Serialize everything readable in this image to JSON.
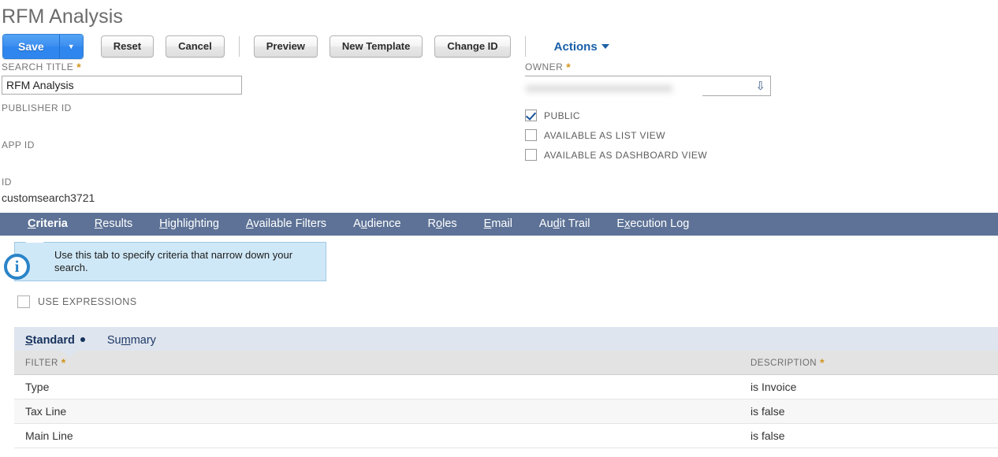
{
  "page": {
    "title": "RFM Analysis"
  },
  "toolbar": {
    "save_label": "Save",
    "save_dropdown_icon": "caret-down-icon",
    "reset_label": "Reset",
    "cancel_label": "Cancel",
    "preview_label": "Preview",
    "new_template_label": "New Template",
    "change_id_label": "Change ID",
    "actions_label": "Actions",
    "actions_caret_icon": "caret-down-icon"
  },
  "form": {
    "left": {
      "search_title_label": "SEARCH TITLE",
      "search_title_required": "*",
      "search_title_value": "RFM Analysis",
      "search_title_placeholder": "",
      "publisher_id_label": "PUBLISHER ID",
      "publisher_id_value": "",
      "app_id_label": "APP ID",
      "app_id_value": "",
      "id_label": "ID",
      "id_value": "customsearch3721"
    },
    "right": {
      "owner_label": "OWNER",
      "owner_required": "*",
      "owner_value": "",
      "owner_dropdown_icon": "chevron-double-down-icon",
      "checkboxes": [
        {
          "label": "PUBLIC",
          "checked": true
        },
        {
          "label": "AVAILABLE AS LIST VIEW",
          "checked": false
        },
        {
          "label": "AVAILABLE AS DASHBOARD VIEW",
          "checked": false
        }
      ]
    }
  },
  "tabs": [
    {
      "label": "Criteria",
      "accel": "C",
      "active": true
    },
    {
      "label": "Results",
      "accel": "R",
      "active": false
    },
    {
      "label": "Highlighting",
      "accel": "H",
      "active": false
    },
    {
      "label": "Available Filters",
      "accel": "A",
      "active": false
    },
    {
      "label": "Audience",
      "accel": "u",
      "active": false
    },
    {
      "label": "Roles",
      "accel": "o",
      "active": false
    },
    {
      "label": "Email",
      "accel": "E",
      "active": false
    },
    {
      "label": "Audit Trail",
      "accel": "d",
      "active": false
    },
    {
      "label": "Execution Log",
      "accel": "x",
      "active": false
    }
  ],
  "tooltip": {
    "icon": "info-icon",
    "text": "Use this tab to specify criteria that narrow down your search."
  },
  "use_expressions": {
    "label": "USE EXPRESSIONS",
    "checked": false
  },
  "subtabs": [
    {
      "label": "Standard",
      "accel": "S",
      "active": true,
      "dot": true
    },
    {
      "label": "Summary",
      "accel": "m",
      "active": false,
      "dot": false
    }
  ],
  "table": {
    "columns": [
      {
        "label": "FILTER",
        "required": "*"
      },
      {
        "label": "DESCRIPTION",
        "required": "*"
      }
    ],
    "rows": [
      {
        "filter": "Type",
        "description": "is Invoice"
      },
      {
        "filter": "Tax Line",
        "description": "is false"
      },
      {
        "filter": "Main Line",
        "description": "is false"
      }
    ]
  },
  "colors": {
    "accent_blue": "#2f86ee",
    "tabbar_bg": "#5d7296",
    "subtab_bg": "#dfe5ef",
    "tooltip_bg": "#cfe8f7",
    "required_star": "#d2951f",
    "link_blue": "#1a5fa8"
  }
}
